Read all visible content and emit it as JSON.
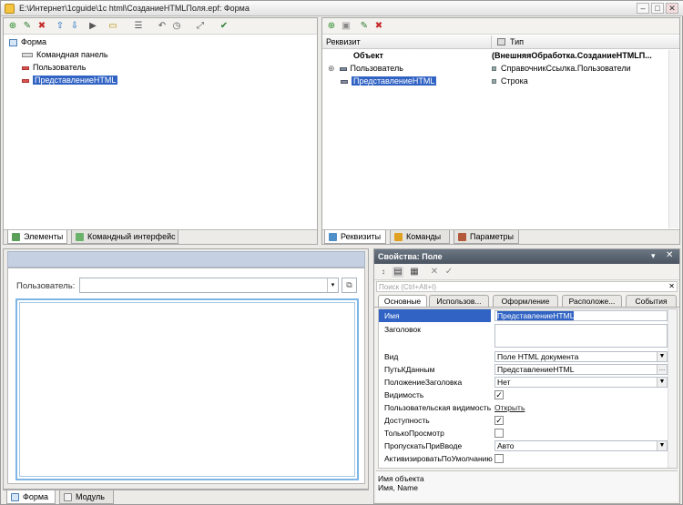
{
  "window": {
    "title": "E:\\Интернет\\1cguide\\1c html\\СозданиеHTMLПоля.epf: Форма"
  },
  "elements_tree": {
    "items": [
      {
        "label": "Форма"
      },
      {
        "label": "Командная панель"
      },
      {
        "label": "Пользователь"
      },
      {
        "label": "ПредставлениеHTML"
      }
    ]
  },
  "left_tabs": [
    "Элементы",
    "Командный интерфейс"
  ],
  "attributes": {
    "columns": [
      "Реквизит",
      "Тип"
    ],
    "rows": [
      {
        "name": "Объект",
        "type": "(ВнешняяОбработка.СозданиеHTMLП..."
      },
      {
        "name": "Пользователь",
        "type": "СправочникСсылка.Пользователи"
      },
      {
        "name": "ПредставлениеHTML",
        "type": "Строка"
      }
    ]
  },
  "right_tabs": [
    "Реквизиты",
    "Команды",
    "Параметры"
  ],
  "preview": {
    "user_label": "Пользователь:"
  },
  "bottom_tabs": [
    "Форма",
    "Модуль"
  ],
  "properties": {
    "title": "Свойства: Поле",
    "search_placeholder": "Поиск (Ctrl+Alt+I)",
    "tabs": [
      "Основные",
      "Использов...",
      "Оформление",
      "Расположе...",
      "События"
    ],
    "rows": [
      {
        "name": "Имя",
        "value": "ПредставлениеHTML"
      },
      {
        "name": "Заголовок",
        "value": ""
      },
      {
        "name": "Вид",
        "value": "Поле HTML документа"
      },
      {
        "name": "ПутьКДанным",
        "value": "ПредставлениеHTML"
      },
      {
        "name": "ПоложениеЗаголовка",
        "value": "Нет"
      },
      {
        "name": "Видимость",
        "value": "✓"
      },
      {
        "name": "Пользовательская видимость",
        "value": "Открыть"
      },
      {
        "name": "Доступность",
        "value": "✓"
      },
      {
        "name": "ТолькоПросмотр",
        "value": ""
      },
      {
        "name": "ПропускатьПриВводе",
        "value": "Авто"
      },
      {
        "name": "АктивизироватьПоУмолчанию",
        "value": ""
      }
    ],
    "description_title": "Имя объекта",
    "description_text": "Имя, Name"
  }
}
